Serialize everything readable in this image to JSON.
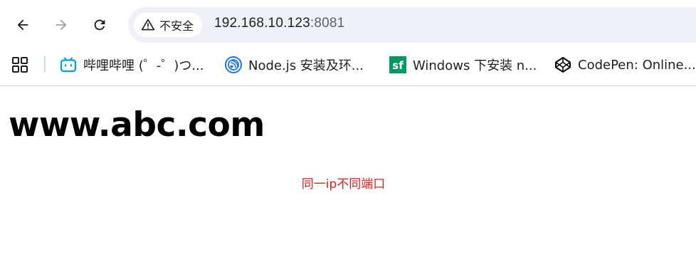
{
  "browser": {
    "toolbar": {
      "back_label": "Back",
      "forward_label": "Forward",
      "reload_label": "Reload"
    },
    "omnibox": {
      "security_label": "不安全",
      "url_host": "192.168.10.123",
      "url_port": ":8081"
    },
    "bookmarks": [
      {
        "label": "哔哩哔哩 (゜-゜)つ...",
        "icon": "bilibili-icon",
        "color": "#00a1d6"
      },
      {
        "label": "Node.js 安装及环...",
        "icon": "runoob-icon",
        "color": "#1a73e8"
      },
      {
        "label": "Windows 下安装 n...",
        "icon": "segmentfault-icon",
        "color": "#009a61"
      },
      {
        "label": "CodePen: Online...",
        "icon": "codepen-icon",
        "color": "#000000"
      }
    ]
  },
  "page": {
    "headline": "www.abc.com",
    "note": "同一ip不同端口",
    "note_color": "#e0201b"
  }
}
